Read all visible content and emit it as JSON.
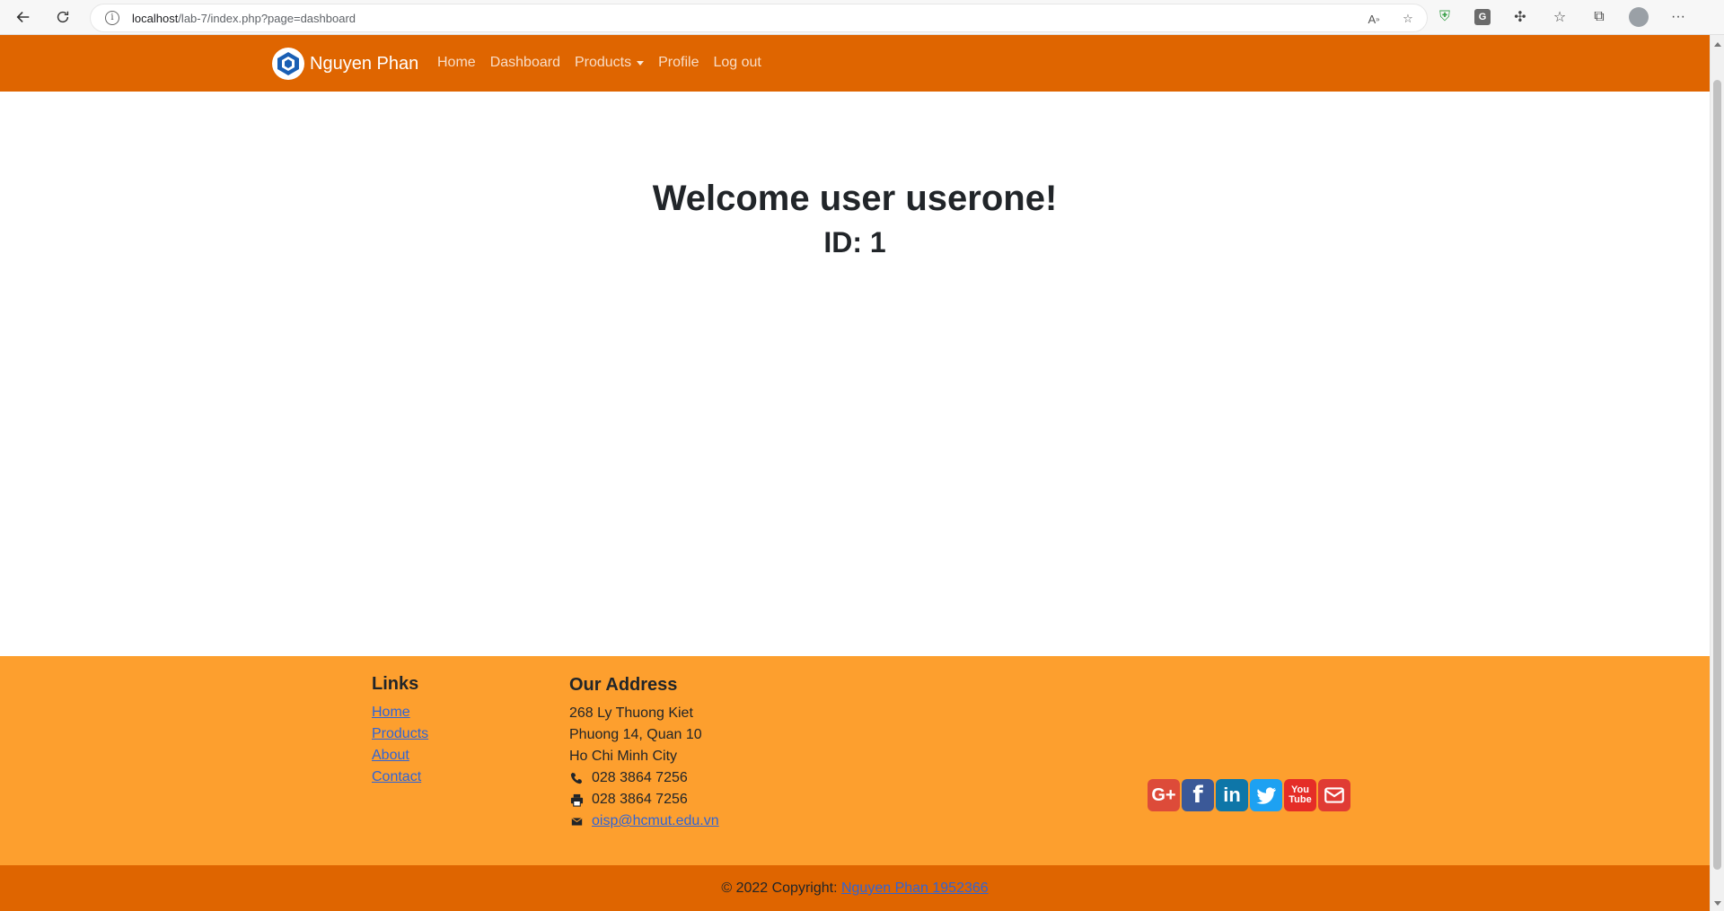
{
  "browser": {
    "url_host": "localhost",
    "url_path": "/lab-7/index.php?page=dashboard"
  },
  "navbar": {
    "brand": "Nguyen Phan",
    "items": [
      {
        "label": "Home"
      },
      {
        "label": "Dashboard"
      },
      {
        "label": "Products"
      },
      {
        "label": "Profile"
      },
      {
        "label": "Log out"
      }
    ],
    "color": "#df6500"
  },
  "main": {
    "welcome": "Welcome user userone!",
    "id_text": "ID: 1"
  },
  "footer": {
    "color": "#fd9f2e",
    "links_heading": "Links",
    "links": [
      {
        "label": "Home"
      },
      {
        "label": "Products"
      },
      {
        "label": "About"
      },
      {
        "label": "Contact"
      }
    ],
    "address_heading": "Our Address",
    "address_lines": [
      "268 Ly Thuong Kiet",
      "Phuong 14, Quan 10",
      "Ho Chi Minh City"
    ],
    "phone": "028 3864 7256",
    "fax": "028 3864 7256",
    "email": "oisp@hcmut.edu.vn",
    "social": [
      {
        "icon": "google-plus-icon"
      },
      {
        "icon": "facebook-icon"
      },
      {
        "icon": "linkedin-icon"
      },
      {
        "icon": "twitter-icon"
      },
      {
        "icon": "youtube-icon"
      },
      {
        "icon": "mail-icon"
      }
    ]
  },
  "copyright": {
    "prefix": "© 2022 Copyright: ",
    "link": "Nguyen Phan 1952366"
  }
}
